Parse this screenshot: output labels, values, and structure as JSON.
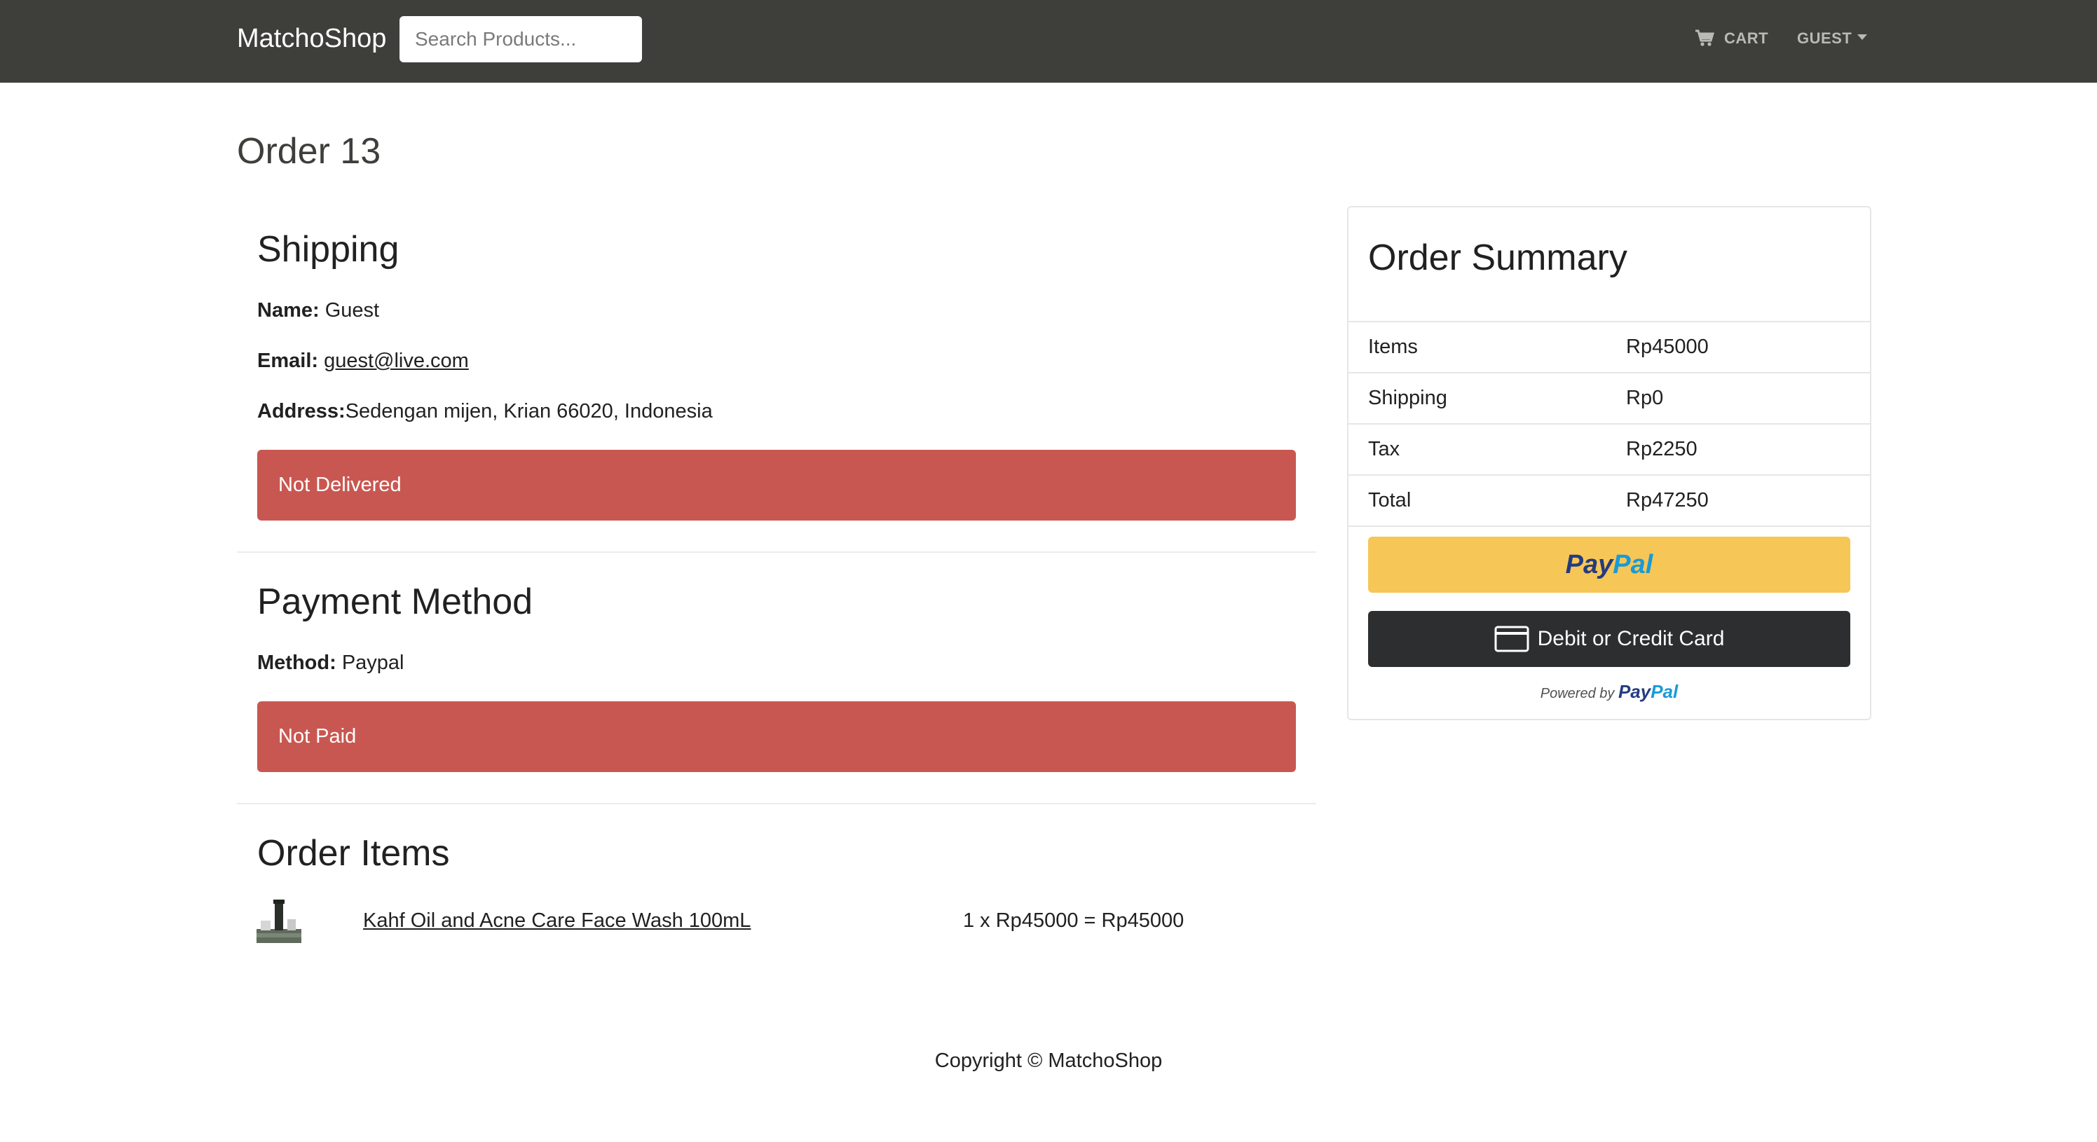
{
  "navbar": {
    "brand": "MatchoShop",
    "search_placeholder": "Search Products...",
    "cart_label": "CART",
    "user_label": "GUEST"
  },
  "order": {
    "title": "Order 13"
  },
  "shipping": {
    "heading": "Shipping",
    "name_label": "Name:",
    "name_value": "Guest",
    "email_label": "Email:",
    "email_value": "guest@live.com",
    "address_label": "Address:",
    "address_value": "Sedengan mijen, Krian 66020, Indonesia",
    "status": "Not Delivered"
  },
  "payment": {
    "heading": "Payment Method",
    "method_label": "Method:",
    "method_value": "Paypal",
    "status": "Not Paid"
  },
  "order_items": {
    "heading": "Order Items",
    "items": [
      {
        "name": "Kahf Oil and Acne Care Face Wash 100mL",
        "price_line": "1 x Rp45000 = Rp45000"
      }
    ]
  },
  "summary": {
    "heading": "Order Summary",
    "rows": [
      {
        "label": "Items",
        "value": "Rp45000"
      },
      {
        "label": "Shipping",
        "value": "Rp0"
      },
      {
        "label": "Tax",
        "value": "Rp2250"
      },
      {
        "label": "Total",
        "value": "Rp47250"
      }
    ],
    "paypal_button": {
      "part1": "Pay",
      "part2": "Pal"
    },
    "card_button_label": "Debit or Credit Card",
    "powered_by": "Powered by",
    "powered_brand": {
      "part1": "Pay",
      "part2": "Pal"
    }
  },
  "footer": {
    "copyright": "Copyright © MatchoShop"
  },
  "colors": {
    "navbar_bg": "#3e3f3a",
    "alert_danger": "#c95751",
    "paypal_yellow": "#f6c657",
    "card_button_bg": "#2c2e2f"
  }
}
